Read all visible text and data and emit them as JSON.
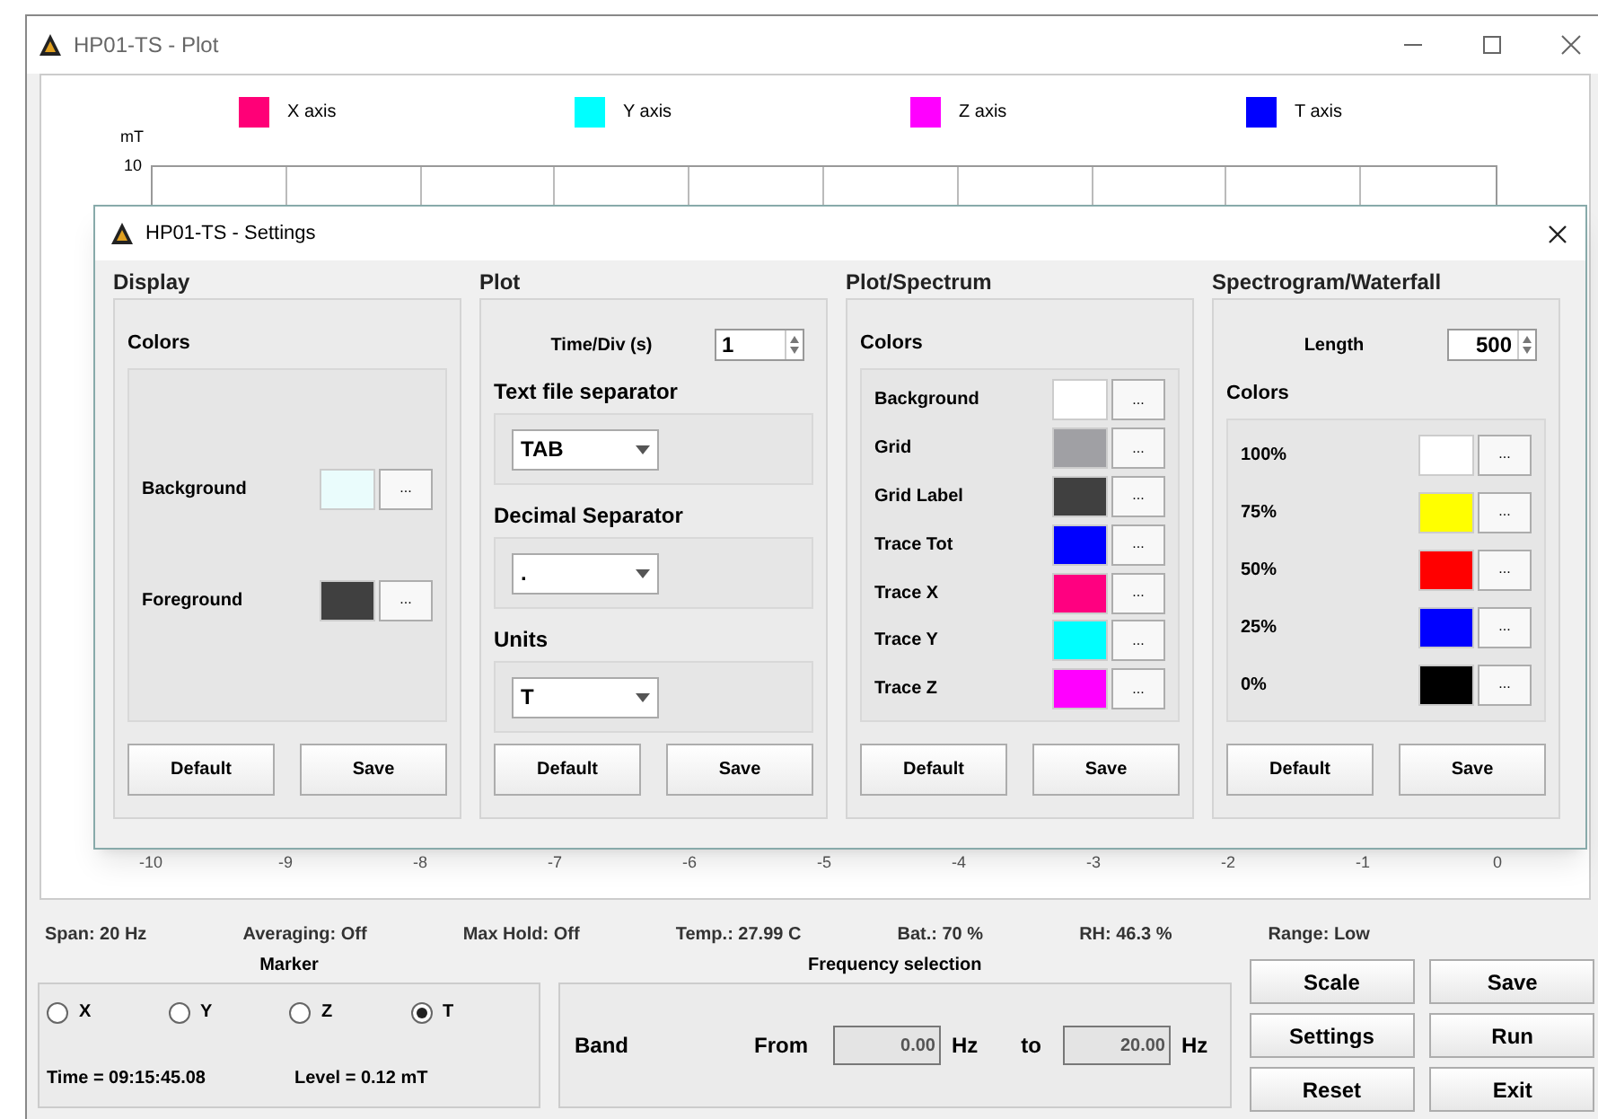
{
  "window": {
    "title": "HP01-TS - Plot"
  },
  "plot": {
    "legend": [
      {
        "label": "X axis",
        "color": "#ff0077"
      },
      {
        "label": "Y axis",
        "color": "#00ffff"
      },
      {
        "label": "Z axis",
        "color": "#ff00ff"
      },
      {
        "label": "T axis",
        "color": "#0000ff"
      }
    ],
    "y_unit": "mT",
    "y_tick": "10",
    "x_ticks": [
      "-10",
      "-9",
      "-8",
      "-7",
      "-6",
      "-5",
      "-4",
      "-3",
      "-2",
      "-1",
      "0"
    ]
  },
  "settings_dialog": {
    "title": "HP01-TS - Settings",
    "sections": [
      {
        "heading": "Display",
        "colors_title": "Colors",
        "colors": [
          {
            "label": "Background",
            "color": "#eafcfc",
            "button": "..."
          },
          {
            "label": "Foreground",
            "color": "#404040",
            "button": "..."
          }
        ],
        "buttons": [
          "Default",
          "Save"
        ]
      },
      {
        "heading": "Plot",
        "spinner": {
          "label": "Time/Div (s)",
          "value": "1"
        },
        "dropdowns": [
          {
            "label": "Text file separator",
            "value": "TAB"
          },
          {
            "label": "Decimal Separator",
            "value": "."
          },
          {
            "label": "Units",
            "value": "T"
          }
        ],
        "buttons": [
          "Default",
          "Save"
        ]
      },
      {
        "heading": "Plot/Spectrum",
        "colors_title": "Colors",
        "colors": [
          {
            "label": "Background",
            "color": "#ffffff",
            "button": "..."
          },
          {
            "label": "Grid",
            "color": "#a0a0a4",
            "button": "..."
          },
          {
            "label": "Grid Label",
            "color": "#404040",
            "button": "..."
          },
          {
            "label": "Trace Tot",
            "color": "#0000ff",
            "button": "..."
          },
          {
            "label": "Trace X",
            "color": "#ff0080",
            "button": "..."
          },
          {
            "label": "Trace Y",
            "color": "#00ffff",
            "button": "..."
          },
          {
            "label": "Trace Z",
            "color": "#ff00ff",
            "button": "..."
          }
        ],
        "buttons": [
          "Default",
          "Save"
        ]
      },
      {
        "heading": "Spectrogram/Waterfall",
        "spinner": {
          "label": "Length",
          "value": "500"
        },
        "colors_title": "Colors",
        "colors": [
          {
            "label": "100%",
            "color": "#ffffff",
            "button": "..."
          },
          {
            "label": "75%",
            "color": "#ffff00",
            "button": "..."
          },
          {
            "label": "50%",
            "color": "#ff0000",
            "button": "..."
          },
          {
            "label": "25%",
            "color": "#0000ff",
            "button": "..."
          },
          {
            "label": "0%",
            "color": "#000000",
            "button": "..."
          }
        ],
        "buttons": [
          "Default",
          "Save"
        ]
      }
    ]
  },
  "status": [
    "Span: 20 Hz",
    "Averaging: Off",
    "Max Hold: Off",
    "Temp.: 27.99 C",
    "Bat.: 70 %",
    "RH: 46.3 %",
    "Range: Low"
  ],
  "marker": {
    "title": "Marker",
    "options": [
      {
        "label": "X",
        "selected": false
      },
      {
        "label": "Y",
        "selected": false
      },
      {
        "label": "Z",
        "selected": false
      },
      {
        "label": "T",
        "selected": true
      }
    ],
    "time": "Time = 09:15:45.08",
    "level": "Level = 0.12 mT"
  },
  "frequency_selection": {
    "title": "Frequency selection",
    "band": "Band",
    "from_label": "From",
    "from_value": "0.00",
    "from_unit": "Hz",
    "to_label": "to",
    "to_value": "20.00",
    "to_unit": "Hz"
  },
  "buttons": [
    "Scale",
    "Save",
    "Settings",
    "Run",
    "Reset",
    "Exit"
  ]
}
